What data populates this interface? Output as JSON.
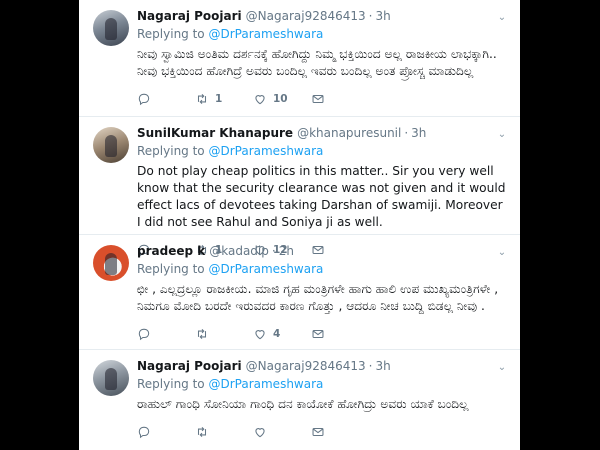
{
  "colors": {
    "link": "#1da1f2",
    "secondary_text": "#657786",
    "divider": "#e6ecf0",
    "background": "#000000"
  },
  "tweets": [
    {
      "name": "Nagaraj Poojari",
      "handle": "@Nagaraj92846413",
      "dot": "·",
      "time": "3h",
      "replying_prefix": "Replying to",
      "replying_to": "@DrParameshwara",
      "text": "ನೀವು ಸ್ವಾಮಿಜಿ ಅಂತಿಮ ದರ್ಶನಕ್ಕೆ ಹೋಗಿದ್ದು ನಿಮ್ಮ ಭಕ್ತಿಯಿಂದ ಅಲ್ಲ ರಾಜಕೀಯ ಲಾಭಕ್ಕಾಗಿ.. ನೀವು ಭಕ್ತಿಯಿಂದ ಹೋಗಿದ್ರೆ ಅವರು ಬಂದಿಲ್ಲ ಇವರು ಬಂದಿಲ್ಲ ಅಂತ ಪ್ರೋಸ್ಚ ಮಾಡುದಿಲ್ಲ",
      "replies": "",
      "retweets": "1",
      "likes": "10",
      "avatar_icon": "user-avatar"
    },
    {
      "name": "SunilKumar Khanapure",
      "handle": "@khanapuresunil",
      "dot": "·",
      "time": "3h",
      "replying_prefix": "Replying to",
      "replying_to": "@DrParameshwara",
      "text": "Do not play cheap politics in this matter.. Sir you very well know that the security clearance was not given and it would effect lacs of devotees taking Darshan of swamiji. Moreover I did not see Rahul and Soniya ji as well.",
      "replies": "",
      "retweets": "1",
      "likes": "12",
      "avatar_icon": "user-avatar"
    },
    {
      "name": "pradeep k",
      "handle": "@kadadip",
      "dot": "·",
      "time": "2h",
      "replying_prefix": "Replying to",
      "replying_to": "@DrParameshwara",
      "text": "ಛೀ , ಎಲ್ಲದ್ರಲ್ಲೂ ರಾಜಕೀಯ. ಮಾಜಿ ಗೃಹ ಮಂತ್ರಿಗಳೇ ಹಾಗು ಹಾಲಿ ಉಪ ಮುಖ್ಯಮಂತ್ರಿಗಳೇ , ನಿಮಗೂ ಮೋದಿ ಬರದೇ ಇರುವದರ ಕಾರಣ ಗೊತ್ತು , ಆದರೂ ನೀಚ ಬುದ್ದಿ ಬಿಡಲ್ಲ ನೀವು .",
      "replies": "",
      "retweets": "",
      "likes": "4",
      "avatar_icon": "user-avatar"
    },
    {
      "name": "Nagaraj Poojari",
      "handle": "@Nagaraj92846413",
      "dot": "·",
      "time": "3h",
      "replying_prefix": "Replying to",
      "replying_to": "@DrParameshwara",
      "text": "ರಾಹುಲ್ ಗಾಂಧಿ ಸೋನಿಯಾ ಗಾಂಧಿ ದನ ಕಾಯೋಕೆ ಹೋಗಿದ್ರು ಅವರು ಯಾಕೆ ಬಂದಿಲ್ಲ",
      "replies": "",
      "retweets": "",
      "likes": "",
      "avatar_icon": "user-avatar"
    }
  ]
}
